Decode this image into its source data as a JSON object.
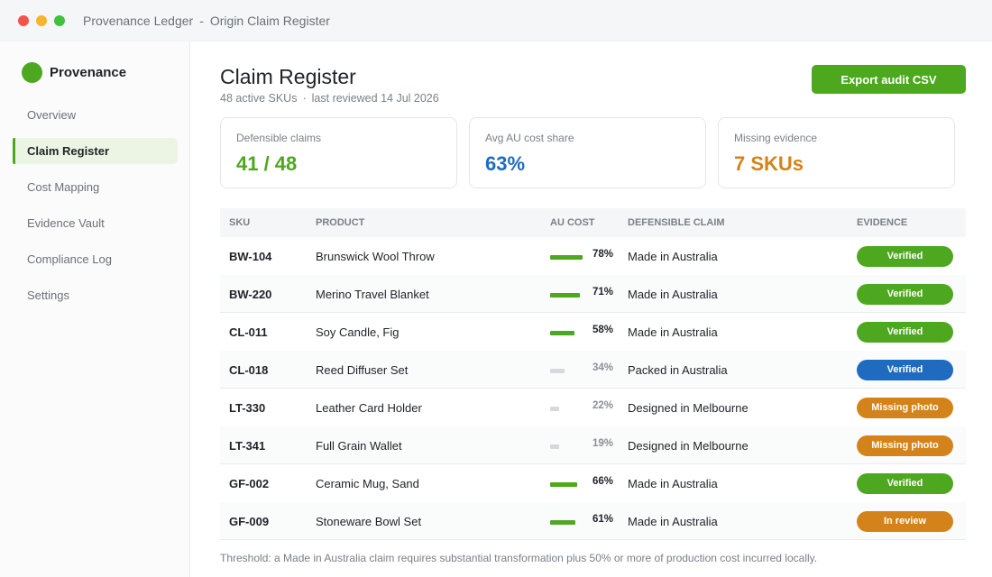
{
  "window": {
    "app_name": "Provenance Ledger",
    "separator": "-",
    "page_name": "Origin Claim Register"
  },
  "sidebar": {
    "brand": "Provenance",
    "items": [
      {
        "label": "Overview",
        "active": false
      },
      {
        "label": "Claim Register",
        "active": true
      },
      {
        "label": "Cost Mapping",
        "active": false
      },
      {
        "label": "Evidence Vault",
        "active": false
      },
      {
        "label": "Compliance Log",
        "active": false
      },
      {
        "label": "Settings",
        "active": false
      }
    ]
  },
  "header": {
    "title": "Claim Register",
    "active_skus": "48 active SKUs",
    "bullet": "·",
    "last_reviewed": "last reviewed 14 Jul 2026",
    "export_label": "Export audit CSV"
  },
  "stats": [
    {
      "label": "Defensible claims",
      "value": "41 / 48",
      "color": "#4ea81f"
    },
    {
      "label": "Avg AU cost share",
      "value": "63%",
      "color": "#1f6bbf"
    },
    {
      "label": "Missing evidence",
      "value": "7 SKUs",
      "color": "#d4831a"
    }
  ],
  "table": {
    "columns": {
      "sku": "SKU",
      "product": "PRODUCT",
      "au_cost": "AU COST",
      "claim": "DEFENSIBLE CLAIM",
      "evidence": "EVIDENCE"
    },
    "rows": [
      {
        "sku": "BW-104",
        "product": "Brunswick Wool Throw",
        "au_cost": "78%",
        "au_cost_value": 78,
        "claim": "Made in Australia",
        "evidence": "Verified",
        "evidence_color": "#4ea81f"
      },
      {
        "sku": "BW-220",
        "product": "Merino Travel Blanket",
        "au_cost": "71%",
        "au_cost_value": 71,
        "claim": "Made in Australia",
        "evidence": "Verified",
        "evidence_color": "#4ea81f"
      },
      {
        "sku": "CL-011",
        "product": "Soy Candle, Fig",
        "au_cost": "58%",
        "au_cost_value": 58,
        "claim": "Made in Australia",
        "evidence": "Verified",
        "evidence_color": "#4ea81f"
      },
      {
        "sku": "CL-018",
        "product": "Reed Diffuser Set",
        "au_cost": "34%",
        "au_cost_value": 34,
        "claim": "Packed in Australia",
        "evidence": "Verified",
        "evidence_color": "#1f6bbf"
      },
      {
        "sku": "LT-330",
        "product": "Leather Card Holder",
        "au_cost": "22%",
        "au_cost_value": 22,
        "claim": "Designed in Melbourne",
        "evidence": "Missing photo",
        "evidence_color": "#d4831a"
      },
      {
        "sku": "LT-341",
        "product": "Full Grain Wallet",
        "au_cost": "19%",
        "au_cost_value": 19,
        "claim": "Designed in Melbourne",
        "evidence": "Missing photo",
        "evidence_color": "#d4831a"
      },
      {
        "sku": "GF-002",
        "product": "Ceramic Mug, Sand",
        "au_cost": "66%",
        "au_cost_value": 66,
        "claim": "Made in Australia",
        "evidence": "Verified",
        "evidence_color": "#4ea81f"
      },
      {
        "sku": "GF-009",
        "product": "Stoneware Bowl Set",
        "au_cost": "61%",
        "au_cost_value": 61,
        "claim": "Made in Australia",
        "evidence": "In review",
        "evidence_color": "#d4831a"
      }
    ]
  },
  "footnote": "Threshold: a Made in Australia claim requires substantial transformation plus 50% or more of production cost incurred locally.",
  "colors": {
    "accent": "#4ea81f",
    "blue": "#1f6bbf",
    "amber": "#d4831a",
    "bar_low": "#d5d9de"
  }
}
